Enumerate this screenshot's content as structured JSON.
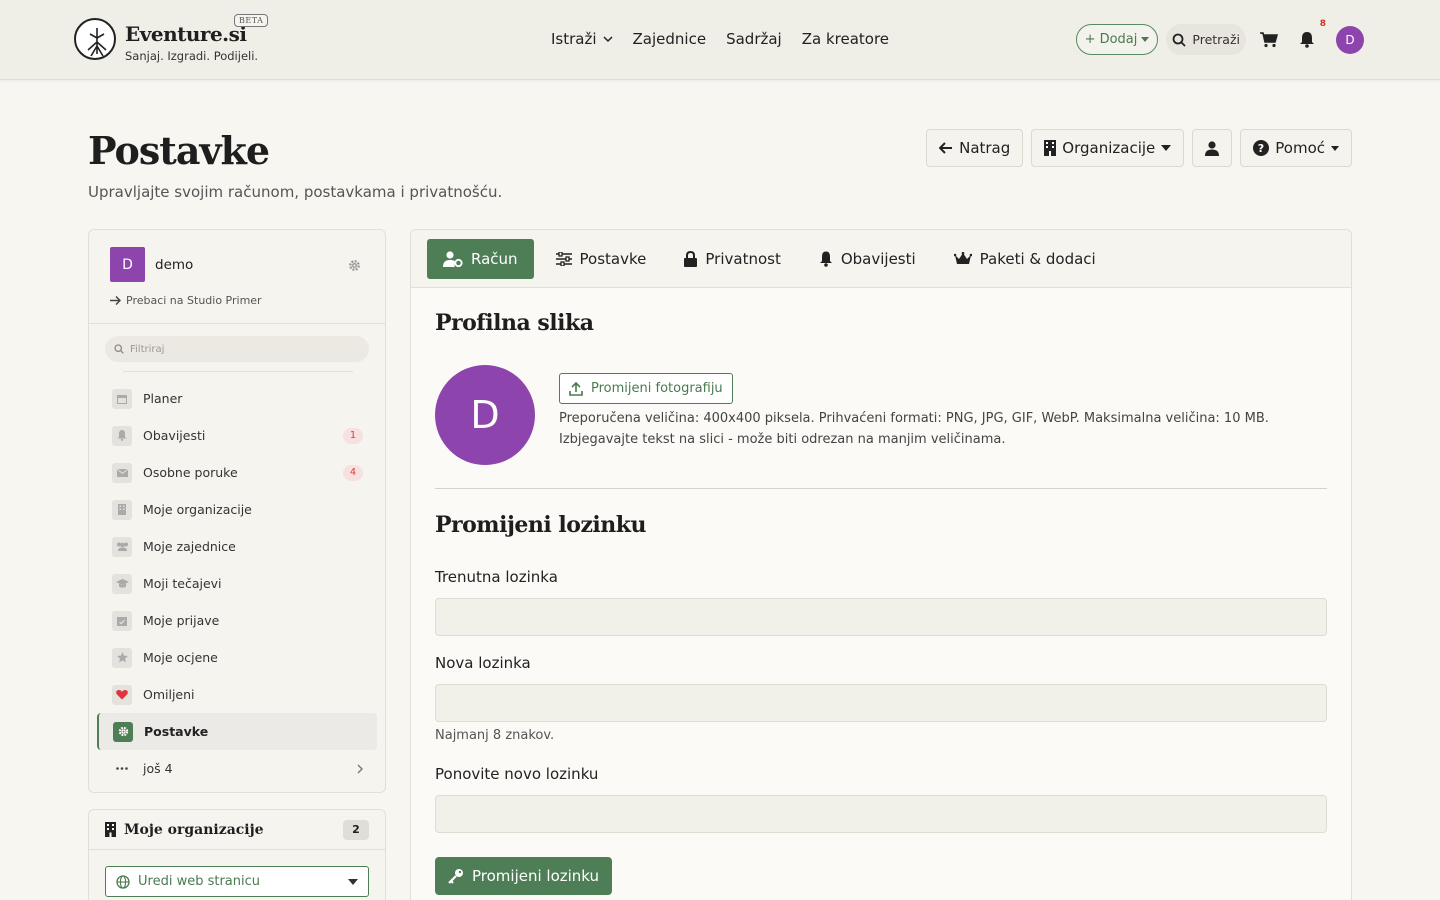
{
  "header": {
    "logo_name": "Eventure.si",
    "logo_tag": "Sanjaj. Izgradi. Podijeli.",
    "beta": "BETA",
    "nav": [
      "Istraži",
      "Zajednice",
      "Sadržaj",
      "Za kreatore"
    ],
    "add_label": "+ Dodaj",
    "search_label": "Pretraži",
    "notif_count": "8",
    "avatar_letter": "D"
  },
  "page": {
    "title": "Postavke",
    "subtitle": "Upravljajte svojim računom, postavkama i privatnošću.",
    "actions": {
      "back": "Natrag",
      "orgs": "Organizacije",
      "help": "Pomoć"
    }
  },
  "sidebar": {
    "user_letter": "D",
    "user_name": "demo",
    "switch_label": "Prebaci na Studio Primer",
    "filter_placeholder": "Filtriraj",
    "items": [
      {
        "label": "Planer",
        "icon": "calendar-icon"
      },
      {
        "label": "Obavijesti",
        "icon": "bell-icon",
        "count": "1"
      },
      {
        "label": "Osobne poruke",
        "icon": "envelope-icon",
        "count": "4"
      },
      {
        "label": "Moje organizacije",
        "icon": "building-icon"
      },
      {
        "label": "Moje zajednice",
        "icon": "users-icon"
      },
      {
        "label": "Moji tečajevi",
        "icon": "graduation-cap-icon"
      },
      {
        "label": "Moje prijave",
        "icon": "calendar-check-icon"
      },
      {
        "label": "Moje ocjene",
        "icon": "star-icon"
      },
      {
        "label": "Omiljeni",
        "icon": "heart-icon"
      },
      {
        "label": "Postavke",
        "icon": "gear-icon",
        "active": true
      },
      {
        "label": "još 4",
        "icon": "ellipsis-icon"
      }
    ]
  },
  "orgs_card": {
    "title": "Moje organizacije",
    "count": "2",
    "select_value": "Uredi web stranicu"
  },
  "tabs": [
    "Račun",
    "Postavke",
    "Privatnost",
    "Obavijesti",
    "Paketi & dodaci"
  ],
  "profile": {
    "title": "Profilna slika",
    "avatar_letter": "D",
    "change_photo": "Promijeni fotografiju",
    "help": "Preporučena veličina: 400x400 piksela. Prihvaćeni formati: PNG, JPG, GIF, WebP. Maksimalna veličina: 10 MB. Izbjegavajte tekst na slici - može biti odrezan na manjim veličinama."
  },
  "password": {
    "title": "Promijeni lozinku",
    "current_label": "Trenutna lozinka",
    "new_label": "Nova lozinka",
    "new_hint": "Najmanj 8 znakov.",
    "repeat_label": "Ponovite novo lozinku",
    "submit": "Promijeni lozinku"
  },
  "colors": {
    "accent": "#4e7e55",
    "avatar": "#8e44ad",
    "badge": "#d04040"
  }
}
